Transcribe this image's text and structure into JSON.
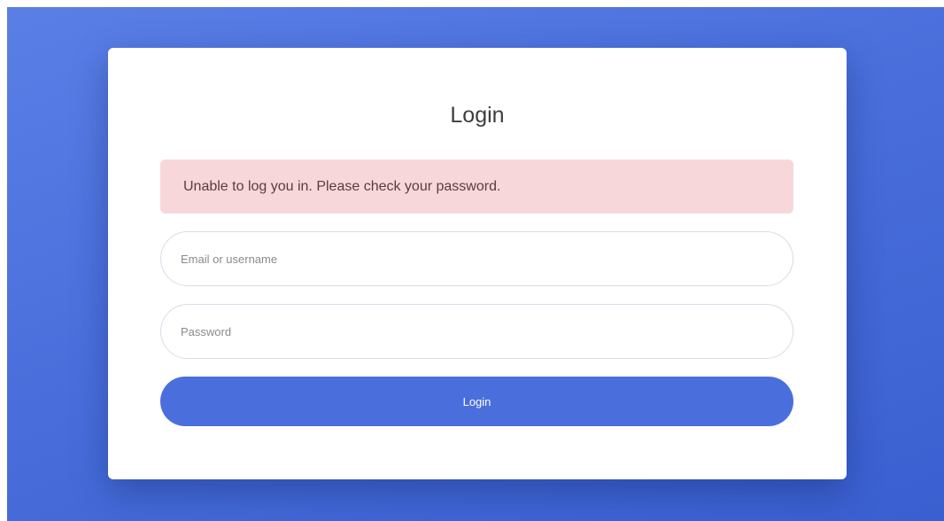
{
  "login_form": {
    "title": "Login",
    "error_message": "Unable to log you in. Please check your password.",
    "email_field": {
      "placeholder": "Email or username",
      "value": ""
    },
    "password_field": {
      "placeholder": "Password",
      "value": ""
    },
    "submit_label": "Login"
  },
  "colors": {
    "background_accent": "#4a6fdc",
    "button": "#4a6fdc",
    "alert_background": "#f8d7da",
    "alert_text": "#5e3a40",
    "card": "#ffffff"
  }
}
